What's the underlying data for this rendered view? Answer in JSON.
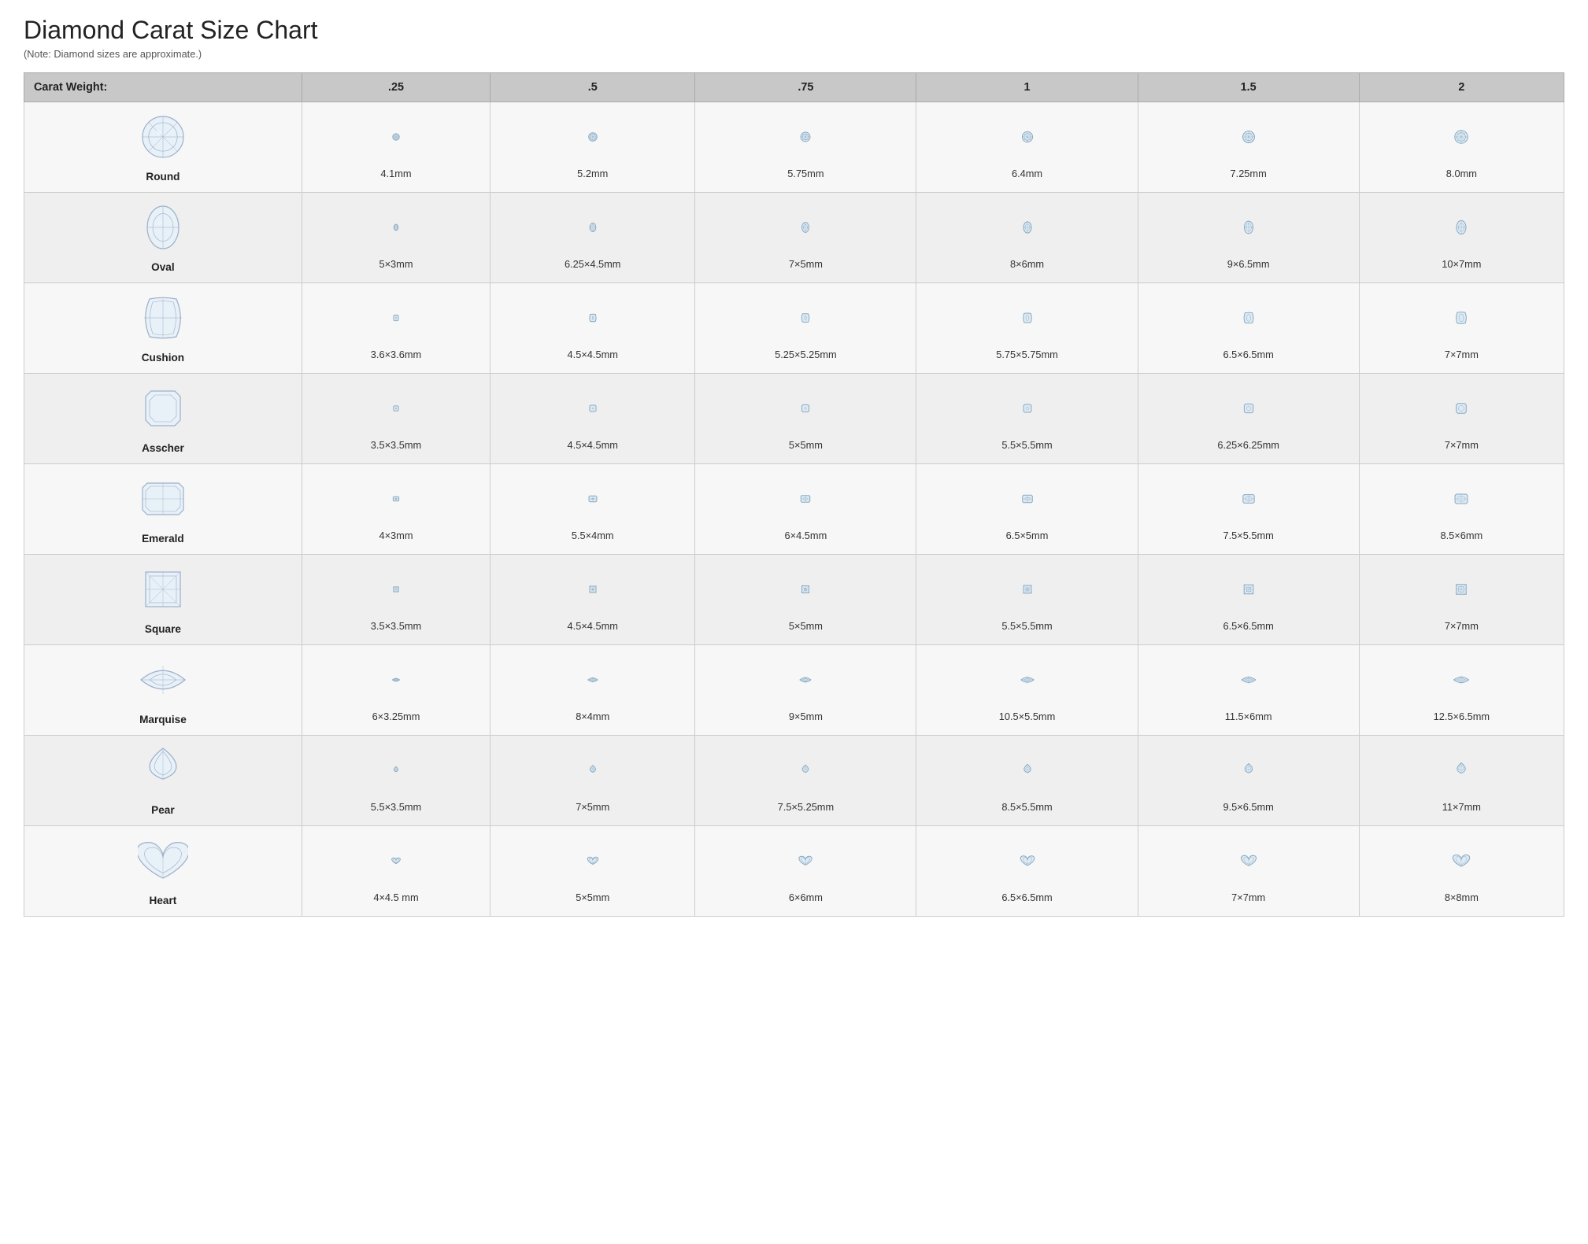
{
  "title": "Diamond Carat Size Chart",
  "subtitle": "(Note: Diamond sizes are approximate.)",
  "header": {
    "col0": "Carat Weight:",
    "col1": ".25",
    "col2": ".5",
    "col3": ".75",
    "col4": "1",
    "col5": "1.5",
    "col6": "2"
  },
  "shapes": [
    {
      "name": "Round",
      "shape": "round",
      "sizes": [
        "4.1mm",
        "5.2mm",
        "5.75mm",
        "6.4mm",
        "7.25mm",
        "8.0mm"
      ],
      "scales": [
        0.38,
        0.48,
        0.54,
        0.6,
        0.68,
        0.75
      ]
    },
    {
      "name": "Oval",
      "shape": "oval",
      "sizes": [
        "5×3mm",
        "6.25×4.5mm",
        "7×5mm",
        "8×6mm",
        "9×6.5mm",
        "10×7mm"
      ],
      "scales": [
        0.35,
        0.5,
        0.58,
        0.65,
        0.72,
        0.78
      ]
    },
    {
      "name": "Cushion",
      "shape": "cushion",
      "sizes": [
        "3.6×3.6mm",
        "4.5×4.5mm",
        "5.25×5.25mm",
        "5.75×5.75mm",
        "6.5×6.5mm",
        "7×7mm"
      ],
      "scales": [
        0.35,
        0.45,
        0.52,
        0.58,
        0.65,
        0.7
      ]
    },
    {
      "name": "Asscher",
      "shape": "asscher",
      "sizes": [
        "3.5×3.5mm",
        "4.5×4.5mm",
        "5×5mm",
        "5.5×5.5mm",
        "6.25×6.25mm",
        "7×7mm"
      ],
      "scales": [
        0.33,
        0.43,
        0.48,
        0.53,
        0.6,
        0.67
      ]
    },
    {
      "name": "Emerald",
      "shape": "emerald",
      "sizes": [
        "4×3mm",
        "5.5×4mm",
        "6×4.5mm",
        "6.5×5mm",
        "7.5×5.5mm",
        "8.5×6mm"
      ],
      "scales": [
        0.33,
        0.45,
        0.52,
        0.57,
        0.65,
        0.72
      ]
    },
    {
      "name": "Square",
      "shape": "square",
      "sizes": [
        "3.5×3.5mm",
        "4.5×4.5mm",
        "5×5mm",
        "5.5×5.5mm",
        "6.5×6.5mm",
        "7×7mm"
      ],
      "scales": [
        0.33,
        0.43,
        0.48,
        0.53,
        0.62,
        0.67
      ]
    },
    {
      "name": "Marquise",
      "shape": "marquise",
      "sizes": [
        "6×3.25mm",
        "8×4mm",
        "9×5mm",
        "10.5×5.5mm",
        "11.5×6mm",
        "12.5×6.5mm"
      ],
      "scales": [
        0.38,
        0.5,
        0.58,
        0.67,
        0.73,
        0.78
      ]
    },
    {
      "name": "Pear",
      "shape": "pear",
      "sizes": [
        "5.5×3.5mm",
        "7×5mm",
        "7.5×5.25mm",
        "8.5×5.5mm",
        "9.5×6.5mm",
        "11×7mm"
      ],
      "scales": [
        0.38,
        0.52,
        0.57,
        0.63,
        0.7,
        0.78
      ]
    },
    {
      "name": "Heart",
      "shape": "heart",
      "sizes": [
        "4×4.5 mm",
        "5×5mm",
        "6×6mm",
        "6.5×6.5mm",
        "7×7mm",
        "8×8mm"
      ],
      "scales": [
        0.38,
        0.48,
        0.58,
        0.63,
        0.68,
        0.76
      ]
    }
  ]
}
